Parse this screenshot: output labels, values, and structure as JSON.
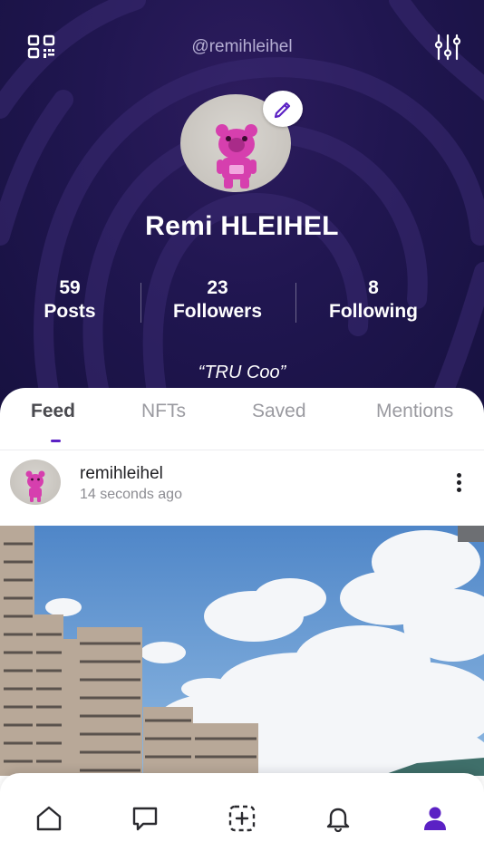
{
  "header": {
    "username": "@remihleihel",
    "display_name": "Remi HLEIHEL",
    "bio": "“TRU Coo”",
    "qr_icon": "qr-code-icon",
    "filter_icon": "sliders-icon",
    "edit_icon": "pencil-icon"
  },
  "stats": [
    {
      "value": "59",
      "label": "Posts"
    },
    {
      "value": "23",
      "label": "Followers"
    },
    {
      "value": "8",
      "label": "Following"
    }
  ],
  "tabs": [
    {
      "label": "Feed",
      "active": true
    },
    {
      "label": "NFTs",
      "active": false
    },
    {
      "label": "Saved",
      "active": false
    },
    {
      "label": "Mentions",
      "active": false
    }
  ],
  "post": {
    "username": "remihleihel",
    "time": "14 seconds ago",
    "more_icon": "more-vertical-icon"
  },
  "bottom_nav": [
    {
      "icon": "home-icon",
      "active": false
    },
    {
      "icon": "chat-icon",
      "active": false
    },
    {
      "icon": "add-post-icon",
      "active": false
    },
    {
      "icon": "bell-icon",
      "active": false
    },
    {
      "icon": "profile-icon",
      "active": true
    }
  ],
  "colors": {
    "header_bg": "#201650",
    "accent": "#5b21c4",
    "avatar_toy": "#d63fae"
  }
}
